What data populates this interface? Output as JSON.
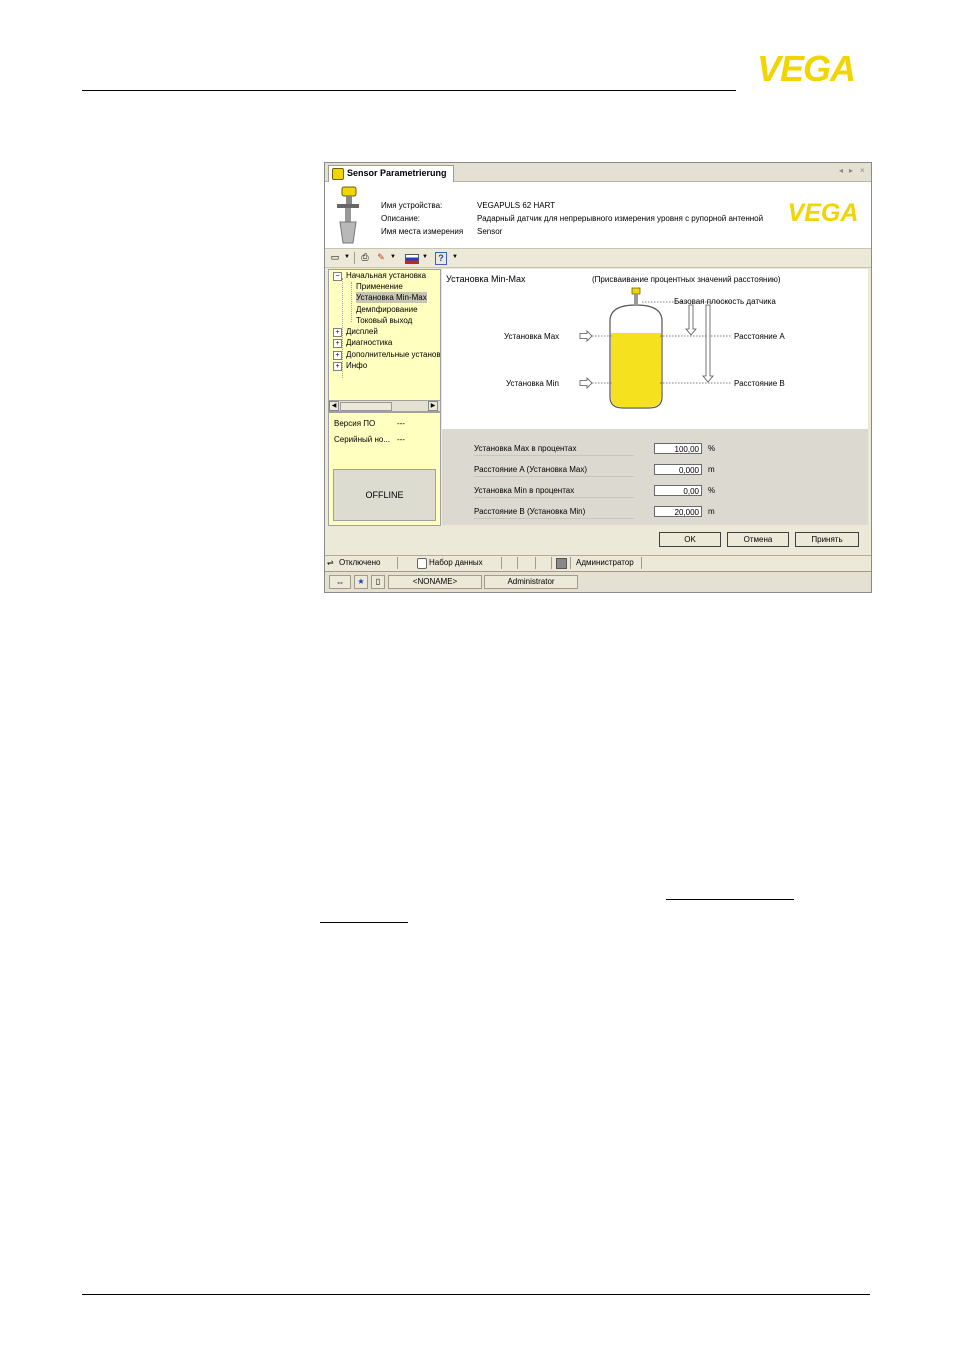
{
  "page": {
    "logo_text": "VEGA"
  },
  "window": {
    "tab_title": "Sensor Parametrierung",
    "controls": [
      "◂",
      "▸",
      "×"
    ],
    "device": {
      "name_label": "Имя устройства:",
      "name_value": "VEGAPULS 62 HART",
      "desc_label": "Описание:",
      "desc_value": "Радарный датчик для непрерывного измерения уровня с рупорной антенной",
      "place_label": "Имя места измерения",
      "place_value": "Sensor",
      "logo_text": "VEGA"
    },
    "tree": {
      "items": [
        {
          "label": "Начальная установка",
          "pm": "−"
        },
        {
          "label": "Применение"
        },
        {
          "label": "Установка Min-Max"
        },
        {
          "label": "Демпфирование"
        },
        {
          "label": "Токовый выход"
        },
        {
          "label": "Дисплей",
          "pm": "+"
        },
        {
          "label": "Диагностика",
          "pm": "+"
        },
        {
          "label": "Дополнительные установ",
          "pm": "+"
        },
        {
          "label": "Инфо",
          "pm": "+"
        }
      ]
    },
    "info": {
      "version_label": "Версия ПО",
      "version_value": "---",
      "serial_label": "Серийный но...",
      "serial_value": "---",
      "offline": "OFFLINE"
    },
    "diagram": {
      "title": "Установка Min-Max",
      "subtitle": "(Присваивание процентных значений расстоянию)",
      "base_plane": "Базовая плоскость датчика",
      "set_max": "Установка Max",
      "set_min": "Установка Min",
      "dist_a": "Расстояние A",
      "dist_b": "Расстояние B",
      "fill_color": "#f6e11f"
    },
    "params": [
      {
        "label": "Установка Max в процентах",
        "value": "100,00",
        "unit": "%"
      },
      {
        "label": "Расстояние A (Установка Max)",
        "value": "0,000",
        "unit": "m"
      },
      {
        "label": "Установка Min в процентах",
        "value": "0,00",
        "unit": "%"
      },
      {
        "label": "Расстояние B (Установка Min)",
        "value": "20,000",
        "unit": "m"
      }
    ],
    "buttons": {
      "ok": "OK",
      "cancel": "Отмена",
      "apply": "Принять"
    },
    "status": {
      "disconnected": "Отключено",
      "dataset": "Набор данных",
      "admin": "Администратор"
    },
    "taskbar": {
      "noname": "<NONAME>",
      "user": "Administrator"
    }
  },
  "colors": {
    "vega_yellow": "#f2d400",
    "tree_bg": "#ffffc0"
  }
}
